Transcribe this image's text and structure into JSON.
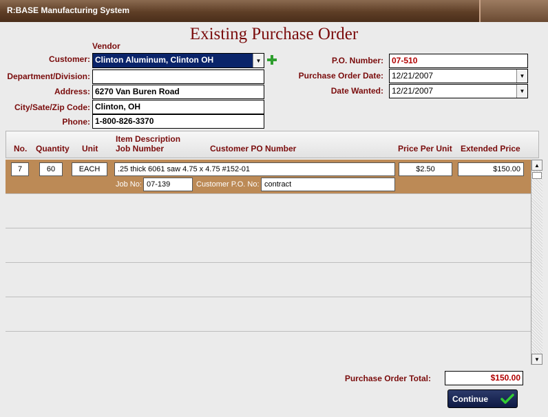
{
  "app": {
    "title": "R:BASE Manufacturing System"
  },
  "page": {
    "title": "Existing Purchase Order"
  },
  "vendor": {
    "caption": "Vendor",
    "customer_label": "Customer:",
    "customer_value": "Clinton Aluminum, Clinton OH",
    "department_label": "Department/Division:",
    "department_value": "",
    "address_label": "Address:",
    "address_value": "6270 Van Buren Road",
    "city_label": "City/Sate/Zip Code:",
    "city_value": "Clinton, OH",
    "phone_label": "Phone:",
    "phone_value": "1-800-826-3370"
  },
  "order": {
    "po_number_label": "P.O. Number:",
    "po_number_value": "07-510",
    "po_date_label": "Purchase Order Date:",
    "po_date_value": "12/21/2007",
    "date_wanted_label": "Date Wanted:",
    "date_wanted_value": "12/21/2007"
  },
  "columns": {
    "no": "No.",
    "quantity": "Quantity",
    "unit": "Unit",
    "item_description": "Item Description",
    "job_number": "Job Number",
    "customer_po": "Customer PO Number",
    "price_per_unit": "Price Per Unit",
    "extended_price": "Extended Price"
  },
  "lines": [
    {
      "no": "7",
      "quantity": "60",
      "unit": "EACH",
      "description": ".25 thick  6061  saw 4.75 x 4.75  #152-01",
      "price": "$2.50",
      "extended": "$150.00",
      "job_label": "Job No:",
      "job_value": "07-139",
      "cust_po_label": "Customer P.O. No:",
      "cust_po_value": "contract"
    }
  ],
  "totals": {
    "label": "Purchase Order Total:",
    "value": "$150.00"
  },
  "actions": {
    "continue_label": "Continue"
  },
  "colors": {
    "accent": "#7a0c0c",
    "selected_row": "#bc8a56",
    "button": "#0e1a44",
    "add_icon": "#2e9e2e",
    "check_icon": "#33cc33"
  }
}
